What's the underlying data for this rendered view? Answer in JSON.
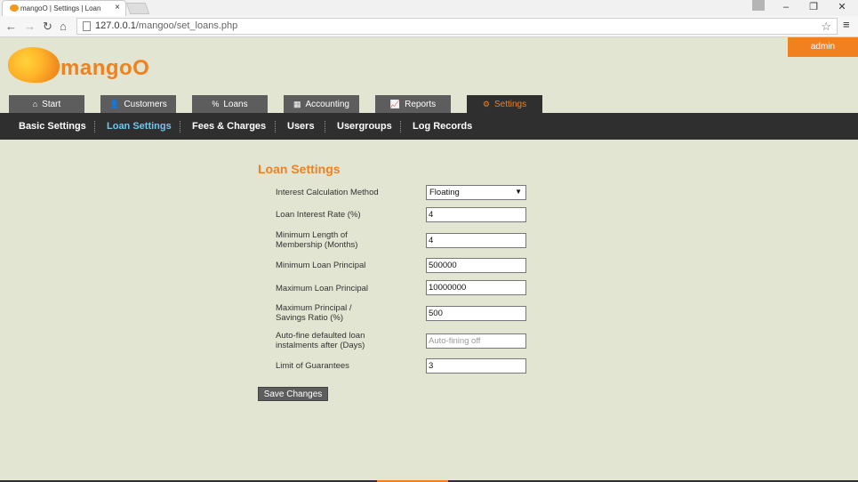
{
  "browser": {
    "tab_title": "mangoO | Settings | Loan",
    "tab_close": "×",
    "url_host": "127.0.0.1",
    "url_path": "/mangoo/set_loans.php",
    "back_icon": "arrow-left",
    "forward_icon": "arrow-right",
    "reload_icon": "reload",
    "home_icon": "home",
    "minimize": "–",
    "restore": "❐",
    "close": "✕",
    "star": "☆",
    "menu": "≡"
  },
  "header": {
    "admin": "admin",
    "logo": "mangoO"
  },
  "tabs": [
    {
      "label": "Start",
      "icon": "⌂"
    },
    {
      "label": "Customers",
      "icon": "👤"
    },
    {
      "label": "Loans",
      "icon": "%"
    },
    {
      "label": "Accounting",
      "icon": "▦"
    },
    {
      "label": "Reports",
      "icon": "📈"
    },
    {
      "label": "Settings",
      "icon": "⚙"
    }
  ],
  "subnav": [
    "Basic Settings",
    "Loan Settings",
    "Fees & Charges",
    "Users",
    "Usergroups",
    "Log Records"
  ],
  "form": {
    "title": "Loan Settings",
    "fields": [
      {
        "label": "Interest Calculation Method",
        "value": "Floating"
      },
      {
        "label": "Loan Interest Rate (%)",
        "value": "4"
      },
      {
        "label": "Minimum Length of Membership (Months)",
        "value": "4"
      },
      {
        "label": "Minimum Loan Principal",
        "value": "500000"
      },
      {
        "label": "Maximum Loan Principal",
        "value": "10000000"
      },
      {
        "label": "Maximum Principal / Savings Ratio (%)",
        "value": "500"
      },
      {
        "label": "Auto-fine defaulted loan instalments after (Days)",
        "placeholder": "Auto-fining off"
      },
      {
        "label": "Limit of Guarantees",
        "value": "3"
      }
    ],
    "save": "Save Changes"
  },
  "colors": {
    "accent": "#f0811e",
    "nav_dark": "#2f2f2f",
    "tab_grey": "#5d5d5d",
    "active_sub": "#6fc7ee",
    "page_bg": "#e2e5d1"
  }
}
